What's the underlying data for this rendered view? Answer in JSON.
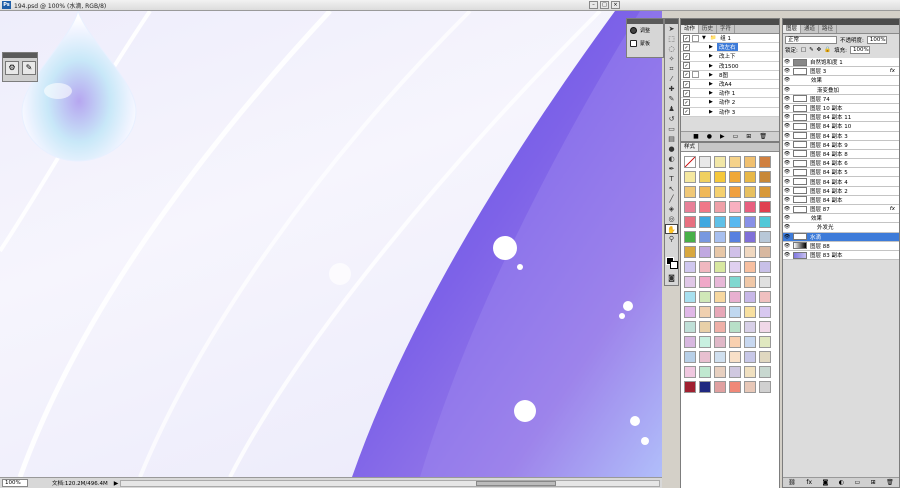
{
  "window": {
    "title": "194.psd @ 100% (水滴, RGB/8)",
    "app_icon": "Ps"
  },
  "status": {
    "zoom": "100%",
    "doc_info": "文档:120.2M/496.4M"
  },
  "adjust_panel": {
    "items": [
      {
        "label": "调整",
        "icon": "adjust-icon"
      },
      {
        "label": "蒙板",
        "icon": "mask-icon"
      }
    ]
  },
  "actions_panel": {
    "tabs": [
      "动作",
      "历史",
      "字符"
    ],
    "rows": [
      {
        "label": "组 1",
        "level": 0,
        "selected": false,
        "has_box": true
      },
      {
        "label": "改左右",
        "level": 1,
        "selected": true,
        "has_box": false
      },
      {
        "label": "改上下",
        "level": 1,
        "selected": false,
        "has_box": false
      },
      {
        "label": "改1500",
        "level": 1,
        "selected": false,
        "has_box": false
      },
      {
        "label": "8图",
        "level": 1,
        "selected": false,
        "has_box": true
      },
      {
        "label": "改A4",
        "level": 1,
        "selected": false,
        "has_box": false
      },
      {
        "label": "动作 1",
        "level": 1,
        "selected": false,
        "has_box": false
      },
      {
        "label": "动作 2",
        "level": 1,
        "selected": false,
        "has_box": false
      },
      {
        "label": "动作 3",
        "level": 1,
        "selected": false,
        "has_box": false
      }
    ]
  },
  "styles_panel": {
    "tab": "样式",
    "colors": [
      "#ffffff",
      "#e8e8e8",
      "#f2e7a8",
      "#f5d28a",
      "#f0c070",
      "#d08040",
      "#f5e8a0",
      "#f0d060",
      "#f5c83c",
      "#f0a838",
      "#e8b848",
      "#c88838",
      "#f0c878",
      "#f0b858",
      "#f5d070",
      "#f0a040",
      "#e8c060",
      "#d89838",
      "#e88098",
      "#f07888",
      "#f0a0a8",
      "#f8b0c0",
      "#e86080",
      "#e04050",
      "#e87080",
      "#40a8e0",
      "#60c0e8",
      "#58b8f0",
      "#8890e8",
      "#50c8d8",
      "#48b048",
      "#7898e0",
      "#a8c0f0",
      "#5880e0",
      "#8070d8",
      "#b8c8d8",
      "#d8a840",
      "#c0a8e0",
      "#e8c8a8",
      "#d0c0e8",
      "#f0d8c0",
      "#d8b8a0",
      "#d0c8f0",
      "#f0b8c0",
      "#d8e8a0",
      "#e0d0f0",
      "#f8c0a0",
      "#c8c0e8",
      "#e0c8e8",
      "#f0a8c8",
      "#e8b8d8",
      "#80d8d0",
      "#f0c8a8",
      "#e0e0e0",
      "#a8e0f0",
      "#d0e8b8",
      "#f8d8a0",
      "#e8b0d0",
      "#c8b8e8",
      "#f0c0c0",
      "#e0b8e8",
      "#f0d0b0",
      "#e8a8b8",
      "#c0d8f0",
      "#f8e0a0",
      "#d8c8f0",
      "#c0e0d8",
      "#e8d0a8",
      "#f0b0a8",
      "#b8e0c8",
      "#d8d0e8",
      "#f0d8e8",
      "#d8b8e0",
      "#c8f0e0",
      "#e0b8c8",
      "#f8d0b0",
      "#c8d8f0",
      "#e0e8c0",
      "#b8d0e8",
      "#e8c0d0",
      "#d0e0f0",
      "#f8e0c8",
      "#c8c8e8",
      "#e0d8c0",
      "#f0c8e0",
      "#c0e8d0",
      "#e8d0c0",
      "#d0c8e0",
      "#f0e0c0",
      "#c8d8d0",
      "#a02030",
      "#202880",
      "#e0a0a0",
      "#f08878",
      "#e8c8b8",
      "#d0d0d0"
    ]
  },
  "layers_panel": {
    "tabs": [
      "图层",
      "通道",
      "路径"
    ],
    "blend_mode": "正常",
    "opacity_label": "不透明度:",
    "opacity": "100%",
    "lock_label": "锁定:",
    "fill_label": "填充:",
    "fill": "100%",
    "rows": [
      {
        "label": "自然饱和度 1",
        "indent": 0,
        "fx": false,
        "selected": false
      },
      {
        "label": "图层 3",
        "indent": 0,
        "fx": true,
        "selected": false
      },
      {
        "label": "效果",
        "indent": 1,
        "fx": false,
        "selected": false
      },
      {
        "label": "渐变叠加",
        "indent": 2,
        "fx": false,
        "selected": false
      },
      {
        "label": "图层 74",
        "indent": 0,
        "fx": false,
        "selected": false
      },
      {
        "label": "图层 10 副本",
        "indent": 0,
        "fx": false,
        "selected": false
      },
      {
        "label": "图层 84 副本 11",
        "indent": 0,
        "fx": false,
        "selected": false
      },
      {
        "label": "图层 84 副本 10",
        "indent": 0,
        "fx": false,
        "selected": false
      },
      {
        "label": "图层 84 副本 3",
        "indent": 0,
        "fx": false,
        "selected": false
      },
      {
        "label": "图层 84 副本 9",
        "indent": 0,
        "fx": false,
        "selected": false
      },
      {
        "label": "图层 84 副本 8",
        "indent": 0,
        "fx": false,
        "selected": false
      },
      {
        "label": "图层 84 副本 6",
        "indent": 0,
        "fx": false,
        "selected": false
      },
      {
        "label": "图层 84 副本 5",
        "indent": 0,
        "fx": false,
        "selected": false
      },
      {
        "label": "图层 84 副本 4",
        "indent": 0,
        "fx": false,
        "selected": false
      },
      {
        "label": "图层 84 副本 2",
        "indent": 0,
        "fx": false,
        "selected": false
      },
      {
        "label": "图层 84 副本",
        "indent": 0,
        "fx": false,
        "selected": false
      },
      {
        "label": "图层 87",
        "indent": 0,
        "fx": true,
        "selected": false
      },
      {
        "label": "效果",
        "indent": 1,
        "fx": false,
        "selected": false
      },
      {
        "label": "外发光",
        "indent": 2,
        "fx": false,
        "selected": false
      },
      {
        "label": "水滴",
        "indent": 0,
        "fx": false,
        "selected": true
      },
      {
        "label": "图层 88",
        "indent": 0,
        "fx": false,
        "selected": false
      },
      {
        "label": "图层 83 副本",
        "indent": 0,
        "fx": false,
        "selected": false
      }
    ]
  }
}
